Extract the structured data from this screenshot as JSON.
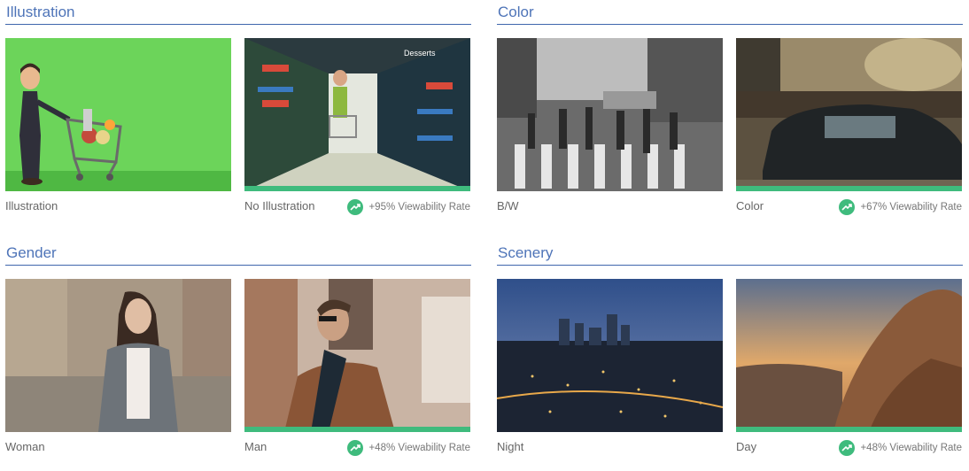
{
  "sections": [
    {
      "title": "Illustration",
      "left": {
        "label": "Illustration",
        "image": "cartoon woman pushing shopping cart on green screen"
      },
      "right": {
        "label": "No Illustration",
        "rate": "+95% Viewability Rate",
        "image": "woman shopping in grocery store aisle"
      }
    },
    {
      "title": "Color",
      "left": {
        "label": "B/W",
        "image": "black and white city crosswalk"
      },
      "right": {
        "label": "Color",
        "rate": "+67% Viewability Rate",
        "image": "city street with passing car in color"
      }
    },
    {
      "title": "Gender",
      "left": {
        "label": "Woman",
        "image": "woman walking on street"
      },
      "right": {
        "label": "Man",
        "rate": "+48% Viewability Rate",
        "image": "man with sunglasses on street"
      }
    },
    {
      "title": "Scenery",
      "left": {
        "label": "Night",
        "image": "city skyline at night"
      },
      "right": {
        "label": "Day",
        "rate": "+48% Viewability Rate",
        "image": "rocky landscape at sunset"
      }
    }
  ],
  "colors": {
    "accent_green": "#3fbb7d",
    "title_blue": "#4e74b8"
  },
  "icons": {
    "rate": "trending-up-icon"
  }
}
